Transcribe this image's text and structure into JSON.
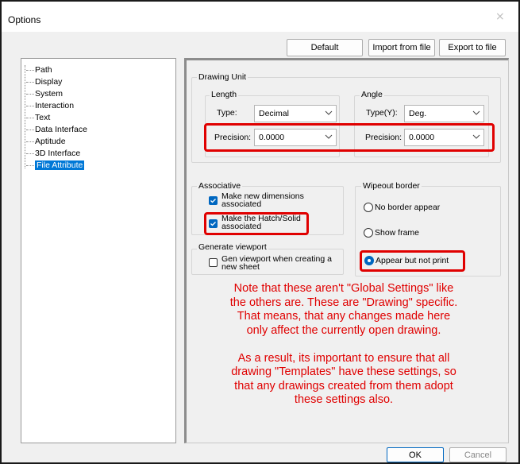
{
  "window": {
    "title": "Options",
    "close_glyph": "×"
  },
  "toolbar": {
    "default_label": "Default",
    "import_label": "Import from file",
    "export_label": "Export to file"
  },
  "tree": {
    "items": [
      "Path",
      "Display",
      "System",
      "Interaction",
      "Text",
      "Data Interface",
      "Aptitude",
      "3D Interface",
      "File Attribute"
    ],
    "selected": "File Attribute"
  },
  "drawing_unit": {
    "group_label": "Drawing Unit",
    "length": {
      "label": "Length",
      "type_label": "Type:",
      "type_value": "Decimal",
      "precision_label": "Precision:",
      "precision_value": "0.0000"
    },
    "angle": {
      "label": "Angle",
      "type_label": "Type(Y):",
      "type_value": "Deg.",
      "precision_label": "Precision:",
      "precision_value": "0.0000"
    }
  },
  "associative": {
    "group_label": "Associative",
    "dims_line1": "Make new dimensions",
    "dims_line2": "associated",
    "dims_checked": true,
    "hatch_line1": "Make the Hatch/Solid",
    "hatch_line2": "associated",
    "hatch_checked": true
  },
  "viewport": {
    "group_label": "Generate viewport",
    "line1": "Gen viewport when creating a",
    "line2": "new sheet",
    "checked": false
  },
  "wipeout": {
    "group_label": "Wipeout border",
    "options": [
      "No border appear",
      "Show frame",
      "Appear but not print"
    ],
    "selected": "Appear but not print"
  },
  "note": {
    "line1": "Note that these aren't \"Global Settings\" like",
    "line2": "the others are. These are \"Drawing\" specific.",
    "line3": "That means, that any changes made here",
    "line4": "only affect the currently open drawing.",
    "line5": "As a result, its important to ensure that all",
    "line6": "drawing \"Templates\" have these settings, so",
    "line7": "that any drawings created from them adopt",
    "line8": "these settings also."
  },
  "footer": {
    "ok_label": "OK",
    "cancel_label": "Cancel"
  },
  "colors": {
    "accent": "#0067c0",
    "selection": "#0078d7",
    "annotation_red": "#e00000"
  }
}
